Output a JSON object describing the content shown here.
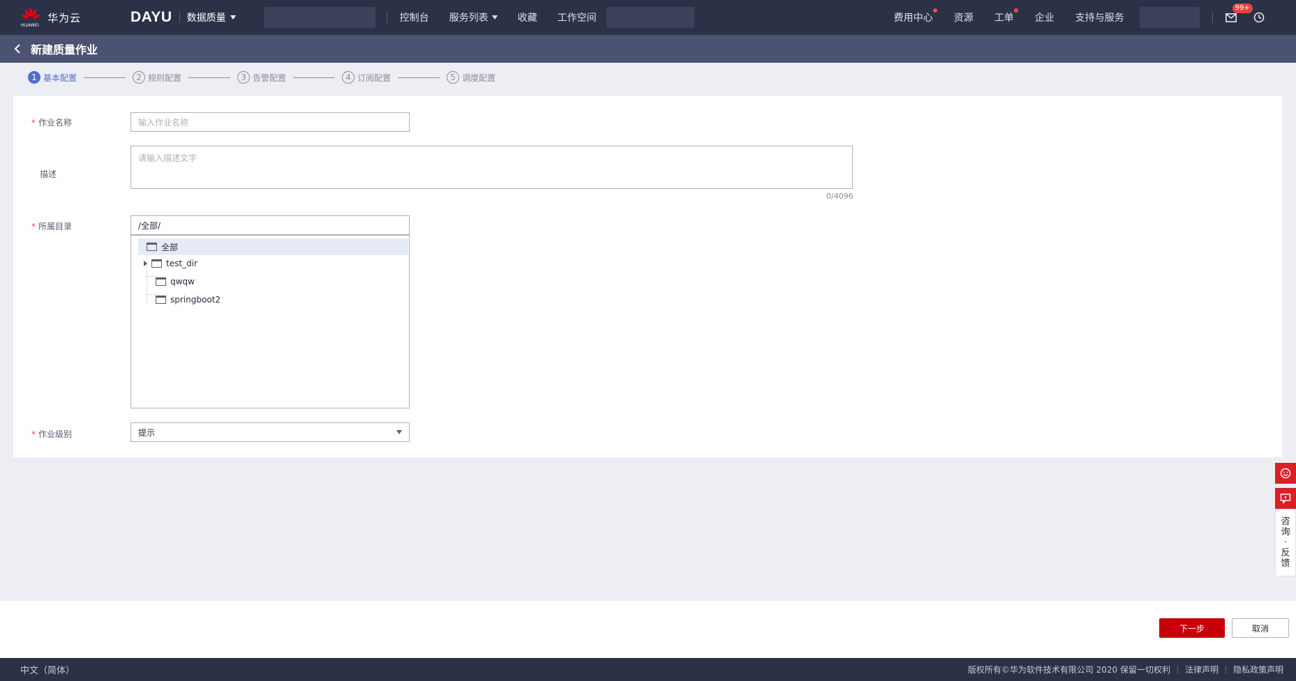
{
  "header": {
    "brand": "华为云",
    "brand_sub": "HUAWEI",
    "product": "DAYU",
    "module": "数据质量",
    "nav": [
      "控制台",
      "服务列表",
      "收藏",
      "工作空间"
    ],
    "right_nav": [
      "费用中心",
      "资源",
      "工单",
      "企业",
      "支持与服务"
    ],
    "mail_badge": "99+"
  },
  "title_bar": {
    "title": "新建质量作业"
  },
  "steps": [
    {
      "num": "1",
      "label": "基本配置"
    },
    {
      "num": "2",
      "label": "规则配置"
    },
    {
      "num": "3",
      "label": "告警配置"
    },
    {
      "num": "4",
      "label": "订阅配置"
    },
    {
      "num": "5",
      "label": "调度配置"
    }
  ],
  "form": {
    "name_label": "作业名称",
    "name_placeholder": "输入作业名称",
    "desc_label": "描述",
    "desc_placeholder": "请输入描述文字",
    "desc_counter": "0/4096",
    "dir_label": "所属目录",
    "dir_value": "/全部/",
    "tree": {
      "root": "全部",
      "children": [
        "test_dir",
        "qwqw",
        "springboot2"
      ]
    },
    "level_label": "作业级别",
    "level_value": "提示"
  },
  "actions": {
    "next": "下一步",
    "cancel": "取消"
  },
  "footer": {
    "lang": "中文（简体）",
    "copyright": "版权所有©华为软件技术有限公司 2020 保留一切权利",
    "legal": "法律声明",
    "privacy": "隐私政策声明"
  },
  "floating": {
    "consult_chars": [
      "咨",
      "询",
      "·",
      "反",
      "馈"
    ]
  },
  "colors": {
    "topbar": "#2b3147",
    "titlebar": "#4c5271",
    "primary": "#c7000b",
    "step_active": "#526ecc"
  }
}
